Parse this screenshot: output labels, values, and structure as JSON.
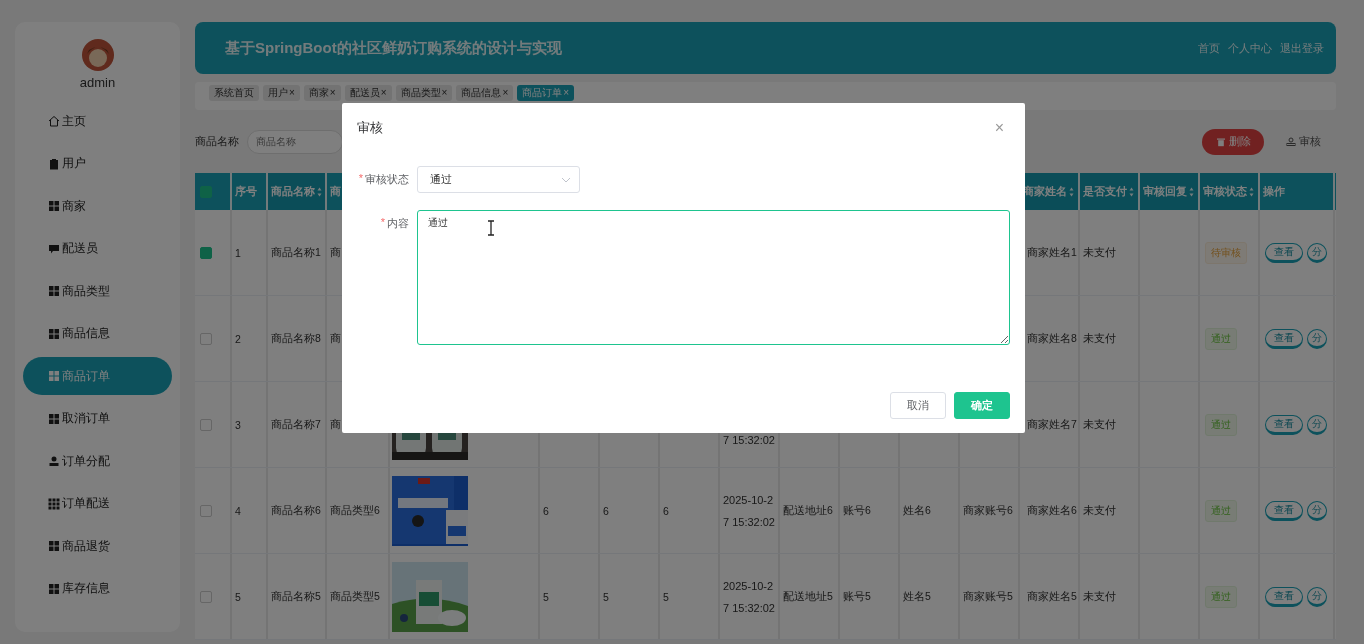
{
  "sidebar": {
    "user": "admin",
    "items": [
      {
        "label": "主页",
        "selected": false
      },
      {
        "label": "用户",
        "selected": false
      },
      {
        "label": "商家",
        "selected": false
      },
      {
        "label": "配送员",
        "selected": false
      },
      {
        "label": "商品类型",
        "selected": false
      },
      {
        "label": "商品信息",
        "selected": false
      },
      {
        "label": "商品订单",
        "selected": true
      },
      {
        "label": "取消订单",
        "selected": false
      },
      {
        "label": "订单分配",
        "selected": false
      },
      {
        "label": "订单配送",
        "selected": false
      },
      {
        "label": "商品退货",
        "selected": false
      },
      {
        "label": "库存信息",
        "selected": false
      }
    ]
  },
  "header": {
    "title": "基于SpringBoot的社区鲜奶订购系统的设计与实现",
    "links": [
      "首页",
      "个人中心",
      "退出登录"
    ]
  },
  "tabs": [
    {
      "label": "系统首页",
      "selected": false
    },
    {
      "label": "用户",
      "close": "×",
      "selected": false
    },
    {
      "label": "商家",
      "close": "×",
      "selected": false
    },
    {
      "label": "配送员",
      "close": "×",
      "selected": false
    },
    {
      "label": "商品类型",
      "close": "×",
      "selected": false
    },
    {
      "label": "商品信息",
      "close": "×",
      "selected": false
    },
    {
      "label": "商品订单",
      "close": "×",
      "selected": true
    }
  ],
  "search": {
    "label": "商品名称",
    "placeholder": "商品名称"
  },
  "actions": [
    {
      "label": "删除",
      "kind": "danger"
    },
    {
      "label": "审核",
      "kind": "plain"
    }
  ],
  "table": {
    "select_all": {
      "partial": true
    },
    "columns": [
      {
        "label": "序号",
        "sortable": false
      },
      {
        "label": "商品名称",
        "sortable": true
      },
      {
        "label": "商"
      },
      {
        "label": "商家姓名",
        "sortable": true
      },
      {
        "label": "是否支付",
        "sortable": true
      },
      {
        "label": "审核回复",
        "sortable": true
      },
      {
        "label": "审核状态",
        "sortable": true
      },
      {
        "label": "操作",
        "sortable": false
      }
    ],
    "rows": [
      {
        "checked": true,
        "index": "1",
        "name": "商品名称1",
        "type": "商",
        "merchant_name": "商家姓名1",
        "paid": "未支付",
        "status": "待审核",
        "approved": false,
        "actions": [
          "查看",
          "分"
        ]
      },
      {
        "checked": false,
        "index": "2",
        "name": "商品名称8",
        "type": "商",
        "merchant_name": "商家姓名8",
        "paid": "未支付",
        "status": "通过",
        "approved": true,
        "actions": [
          "查看",
          "分"
        ]
      },
      {
        "checked": false,
        "index": "3",
        "name": "商品名称7",
        "type": "商",
        "image": {
          "kind": "picture"
        },
        "time": [
          "7 15:32:02"
        ],
        "merchant_name": "商家姓名7",
        "paid": "未支付",
        "status": "通过",
        "approved": true,
        "actions": [
          "查看",
          "分"
        ]
      },
      {
        "checked": false,
        "index": "4",
        "name": "商品名称6",
        "type": "商品类型6",
        "image": {
          "kind": "picture"
        },
        "c6": "6",
        "c7": "6",
        "c8": "6",
        "time": [
          "2025-10-2",
          "7 15:32:02"
        ],
        "address": "配送地址6",
        "account": "账号6",
        "person": "姓名6",
        "merchant_account": "商家账号6",
        "merchant_name": "商家姓名6",
        "paid": "未支付",
        "status": "通过",
        "approved": true,
        "actions": [
          "查看",
          "分"
        ]
      },
      {
        "checked": false,
        "index": "5",
        "name": "商品名称5",
        "type": "商品类型5",
        "image": {
          "kind": "picture"
        },
        "c6": "5",
        "c7": "5",
        "c8": "5",
        "time": [
          "2025-10-2",
          "7 15:32:02"
        ],
        "address": "配送地址5",
        "account": "账号5",
        "person": "姓名5",
        "merchant_account": "商家账号5",
        "merchant_name": "商家姓名5",
        "paid": "未支付",
        "status": "通过",
        "approved": true,
        "actions": [
          "查看",
          "分"
        ]
      }
    ]
  },
  "dialog": {
    "title": "审核",
    "close": "×",
    "fields": [
      {
        "kind": "select",
        "required_mark": "*",
        "label": "审核状态",
        "value": "通过"
      },
      {
        "kind": "textarea",
        "required_mark": "*",
        "label": "内容",
        "value": "通过"
      }
    ],
    "buttons": [
      {
        "label": "取消",
        "kind": "plain"
      },
      {
        "label": "确定",
        "kind": "primary"
      }
    ]
  }
}
